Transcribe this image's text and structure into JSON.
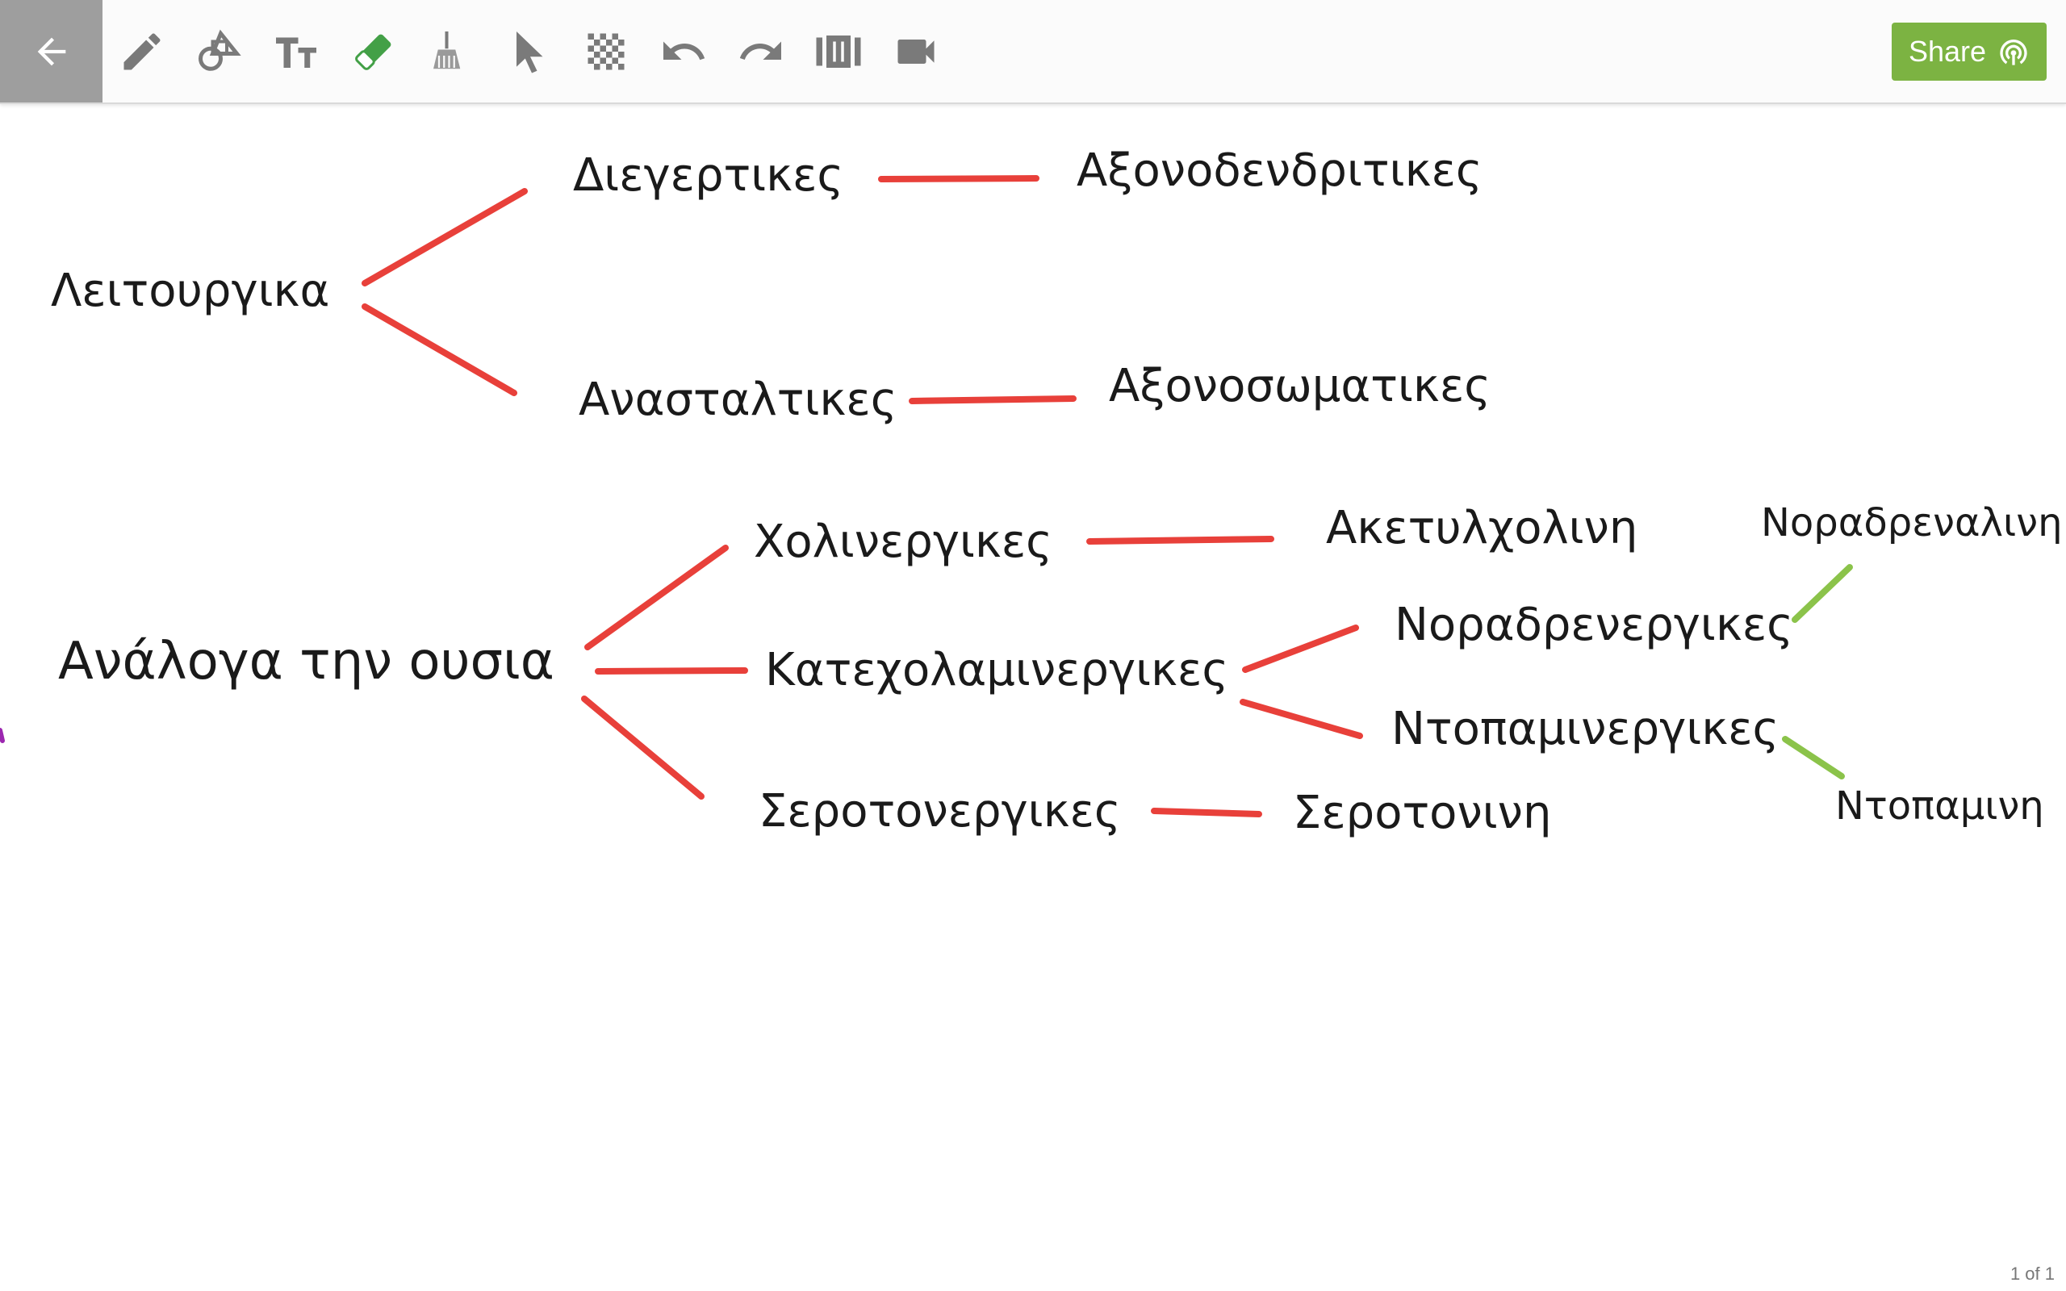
{
  "toolbar": {
    "tools": [
      {
        "name": "back-arrow-icon"
      },
      {
        "name": "pencil-icon"
      },
      {
        "name": "shapes-icon"
      },
      {
        "name": "text-icon"
      },
      {
        "name": "eraser-icon"
      },
      {
        "name": "broom-icon"
      },
      {
        "name": "pointer-icon"
      },
      {
        "name": "background-pattern-icon"
      },
      {
        "name": "undo-icon"
      },
      {
        "name": "redo-icon"
      },
      {
        "name": "slides-icon"
      },
      {
        "name": "video-camera-icon"
      }
    ],
    "share_label": "Share",
    "share_color": "#7cb342"
  },
  "canvas": {
    "stroke_color_red": "#e8403a",
    "stroke_color_green": "#8bc34a",
    "notes": {
      "leitourgika": "Λειτουργικα",
      "diegertikes": "Διεγερτικες",
      "axonodendritikes": "Αξονοδενδριτικες",
      "anastaltikes": "Ανασταλτικες",
      "axonosomatikes": "Αξονοσωματικες",
      "analoga": "Ανάλογα την ουσια",
      "cholinergikes": "Χολινεργικες",
      "aketylcholini": "Ακετυλχολινη",
      "noradrenalini": "Νοραδρεναλινη",
      "katecholaminergikes": "Κατεχολαμινεργικες",
      "noradrenergikes": "Νοραδρενεργικες",
      "ntopaminergikes": "Ντοπαμινεργικες",
      "ntopamini": "Ντοπαμινη",
      "serotonergikes": "Σεροτονεργικες",
      "serotonini": "Σεροτονινη"
    }
  },
  "footer": {
    "page_indicator": "1 of 1"
  }
}
